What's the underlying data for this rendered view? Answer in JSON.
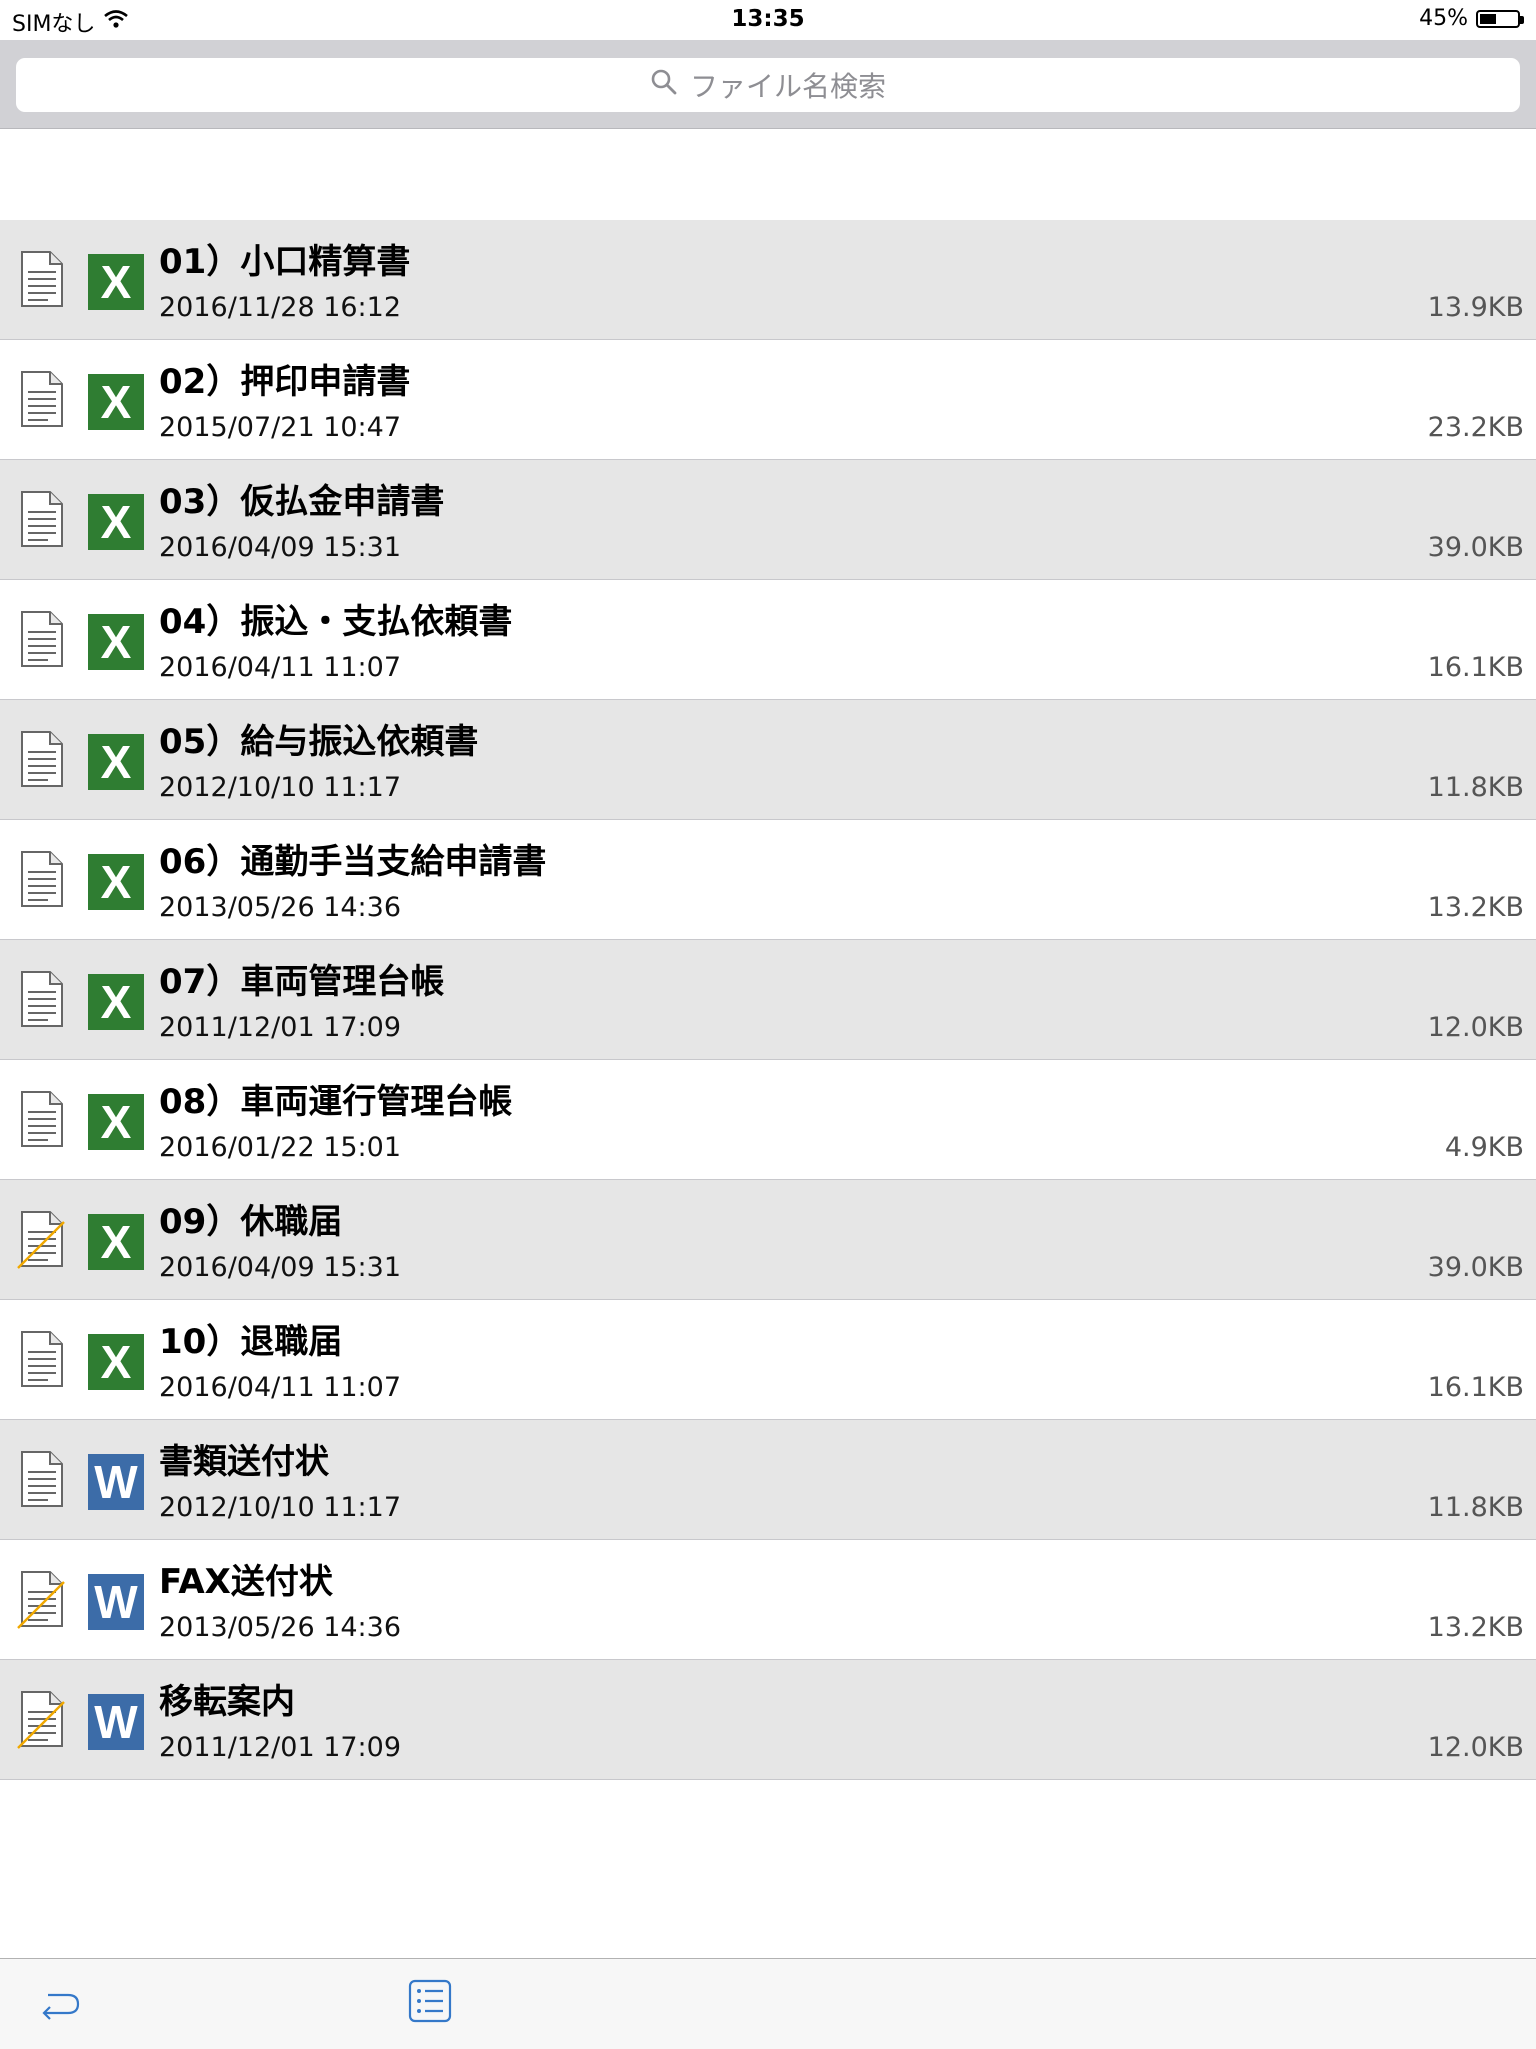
{
  "status_bar": {
    "carrier": "SIMなし",
    "time": "13:35",
    "battery": "45%",
    "battery_level": 0.45
  },
  "search": {
    "placeholder": "ファイル名検索"
  },
  "colors": {
    "excel": "#2f7d32",
    "word": "#3c6ca8",
    "row_shaded": "#e6e6e6",
    "accent": "#3478c9",
    "edited_mark": "#f0a800"
  },
  "files": [
    {
      "name": "01）小口精算書",
      "date": "2016/11/28 16:12",
      "size": "13.9KB",
      "type": "excel",
      "app_letter": "X",
      "edited": false
    },
    {
      "name": "02）押印申請書",
      "date": "2015/07/21 10:47",
      "size": "23.2KB",
      "type": "excel",
      "app_letter": "X",
      "edited": false
    },
    {
      "name": "03）仮払金申請書",
      "date": "2016/04/09 15:31",
      "size": "39.0KB",
      "type": "excel",
      "app_letter": "X",
      "edited": false
    },
    {
      "name": "04）振込・支払依頼書",
      "date": "2016/04/11 11:07",
      "size": "16.1KB",
      "type": "excel",
      "app_letter": "X",
      "edited": false
    },
    {
      "name": "05）給与振込依頼書",
      "date": "2012/10/10 11:17",
      "size": "11.8KB",
      "type": "excel",
      "app_letter": "X",
      "edited": false
    },
    {
      "name": "06）通勤手当支給申請書",
      "date": "2013/05/26 14:36",
      "size": "13.2KB",
      "type": "excel",
      "app_letter": "X",
      "edited": false
    },
    {
      "name": "07）車両管理台帳",
      "date": "2011/12/01 17:09",
      "size": "12.0KB",
      "type": "excel",
      "app_letter": "X",
      "edited": false
    },
    {
      "name": "08）車両運行管理台帳",
      "date": "2016/01/22 15:01",
      "size": "4.9KB",
      "type": "excel",
      "app_letter": "X",
      "edited": false
    },
    {
      "name": "09）休職届",
      "date": "2016/04/09 15:31",
      "size": "39.0KB",
      "type": "excel",
      "app_letter": "X",
      "edited": true
    },
    {
      "name": "10）退職届",
      "date": "2016/04/11 11:07",
      "size": "16.1KB",
      "type": "excel",
      "app_letter": "X",
      "edited": false
    },
    {
      "name": "書類送付状",
      "date": "2012/10/10 11:17",
      "size": "11.8KB",
      "type": "word",
      "app_letter": "W",
      "edited": false
    },
    {
      "name": "FAX送付状",
      "date": "2013/05/26 14:36",
      "size": "13.2KB",
      "type": "word",
      "app_letter": "W",
      "edited": true
    },
    {
      "name": "移転案内",
      "date": "2011/12/01 17:09",
      "size": "12.0KB",
      "type": "word",
      "app_letter": "W",
      "edited": true
    }
  ],
  "toolbar": {
    "back_icon": "return-arrow-icon",
    "list_icon": "list-icon"
  }
}
